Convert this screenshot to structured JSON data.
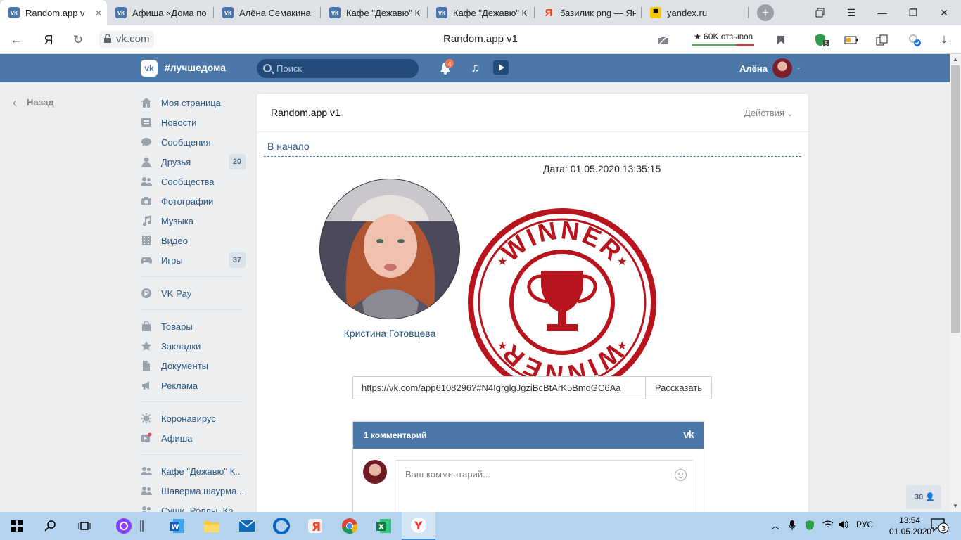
{
  "browser": {
    "tabs": [
      {
        "label": "Random.app v",
        "favicon": "vk-icon",
        "active": true
      },
      {
        "label": "Афиша «Дома по",
        "favicon": "vk-icon"
      },
      {
        "label": "Алёна Семакина",
        "favicon": "vk-icon"
      },
      {
        "label": "Кафе \"Дежавю\" К",
        "favicon": "vk-icon"
      },
      {
        "label": "Кафе \"Дежавю\" К",
        "favicon": "vk-icon"
      },
      {
        "label": "базилик png — Ян",
        "favicon": "yandex-icon"
      },
      {
        "label": "yandex.ru",
        "favicon": "yandex-zen-icon"
      }
    ],
    "domain": "vk.com",
    "page_title": "Random.app v1",
    "reviews": "★ 60K отзывов",
    "extension_badge": "5"
  },
  "vk_header": {
    "tag": "#лучшедома",
    "search_placeholder": "Поиск",
    "notifications": "4",
    "user_name": "Алёна"
  },
  "back_label": "Назад",
  "menu": [
    {
      "label": "Моя страница",
      "icon": "home-icon"
    },
    {
      "label": "Новости",
      "icon": "news-icon"
    },
    {
      "label": "Сообщения",
      "icon": "messages-icon"
    },
    {
      "label": "Друзья",
      "icon": "friends-icon",
      "count": "20"
    },
    {
      "label": "Сообщества",
      "icon": "groups-icon"
    },
    {
      "label": "Фотографии",
      "icon": "camera-icon"
    },
    {
      "label": "Музыка",
      "icon": "music-icon"
    },
    {
      "label": "Видео",
      "icon": "video-icon"
    },
    {
      "label": "Игры",
      "icon": "gamepad-icon",
      "count": "37"
    }
  ],
  "menu2": [
    {
      "label": "VK Pay",
      "icon": "vkpay-icon"
    }
  ],
  "menu3": [
    {
      "label": "Товары",
      "icon": "bag-icon"
    },
    {
      "label": "Закладки",
      "icon": "star-icon"
    },
    {
      "label": "Документы",
      "icon": "document-icon"
    },
    {
      "label": "Реклама",
      "icon": "megaphone-icon"
    }
  ],
  "menu4": [
    {
      "label": "Коронавирус",
      "icon": "virus-icon"
    },
    {
      "label": "Афиша",
      "icon": "afisha-icon"
    }
  ],
  "menu5": [
    {
      "label": "Кафе \"Дежавю\" К..",
      "icon": "group-icon"
    },
    {
      "label": "Шаверма шаурма...",
      "icon": "group-icon"
    },
    {
      "label": "Суши. Роллы. Кр...",
      "icon": "group-icon"
    }
  ],
  "app": {
    "title": "Random.app v1",
    "actions_label": "Действия",
    "breadcrumb": "В начало",
    "date": "Дата: 01.05.2020 13:35:15",
    "winner_name": "Кристина Готовцева",
    "stamp_text": "WINNER",
    "share_url": "https://vk.com/app6108296?#N4IgrglgJgziBcBtArK5BmdGC6Aa",
    "share_button": "Рассказать"
  },
  "comments": {
    "header": "1 комментарий",
    "placeholder": "Ваш комментарий..."
  },
  "online_count": "30",
  "taskbar": {
    "lang": "РУС",
    "time": "13:54",
    "date": "01.05.2020",
    "notifications": "3"
  },
  "colors": {
    "vk_blue": "#4a76a8",
    "link": "#2a5885",
    "stamp_red": "#b8141e"
  }
}
